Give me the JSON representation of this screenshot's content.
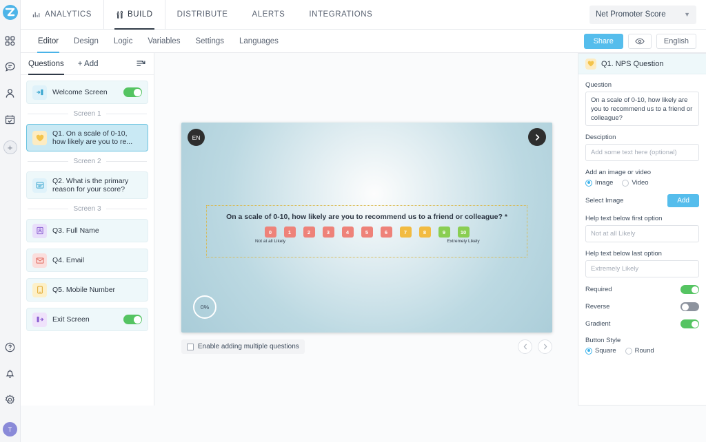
{
  "rail": {
    "logo": "zoho-logo",
    "items": [
      {
        "name": "dashboard-grid-icon"
      },
      {
        "name": "chat-icon"
      },
      {
        "name": "contacts-icon"
      },
      {
        "name": "calendar-check-icon"
      }
    ],
    "add_label": "+",
    "bottom": [
      {
        "name": "help-icon"
      },
      {
        "name": "notifications-icon"
      },
      {
        "name": "settings-gear-icon"
      }
    ],
    "avatar_initial": "T"
  },
  "topnav": {
    "items": [
      {
        "label": "ANALYTICS",
        "icon": "bar-chart-icon",
        "active": false
      },
      {
        "label": "BUILD",
        "icon": "tools-icon",
        "active": true
      },
      {
        "label": "DISTRIBUTE",
        "icon": "",
        "active": false
      },
      {
        "label": "ALERTS",
        "icon": "",
        "active": false
      },
      {
        "label": "INTEGRATIONS",
        "icon": "",
        "active": false
      }
    ],
    "survey_selected": "Net Promoter Score"
  },
  "subnav": {
    "items": [
      {
        "label": "Editor",
        "active": true
      },
      {
        "label": "Design",
        "active": false
      },
      {
        "label": "Logic",
        "active": false
      },
      {
        "label": "Variables",
        "active": false
      },
      {
        "label": "Settings",
        "active": false
      },
      {
        "label": "Languages",
        "active": false
      }
    ],
    "share_label": "Share",
    "preview_icon": "eye-icon",
    "language_label": "English"
  },
  "questions_panel": {
    "tab_label": "Questions",
    "add_label": "+ Add",
    "reorder_icon": "reorder-undo-icon",
    "items": [
      {
        "type": "item",
        "icon": "welcome-screen-icon",
        "label": "Welcome Screen",
        "toggle": "on",
        "selected": false
      },
      {
        "type": "divider",
        "label": "Screen 1"
      },
      {
        "type": "item",
        "icon": "nps-heart-icon",
        "label": "Q1. On a scale of 0-10, how likely are you to re...",
        "toggle": null,
        "selected": true
      },
      {
        "type": "divider",
        "label": "Screen 2"
      },
      {
        "type": "item",
        "icon": "multiline-text-icon",
        "label": "Q2. What is the primary reason for your score?",
        "toggle": null,
        "selected": false
      },
      {
        "type": "divider",
        "label": "Screen 3"
      },
      {
        "type": "item",
        "icon": "name-card-icon",
        "label": "Q3. Full Name",
        "toggle": null,
        "selected": false
      },
      {
        "type": "item",
        "icon": "email-icon",
        "label": "Q4. Email",
        "toggle": null,
        "selected": false
      },
      {
        "type": "item",
        "icon": "mobile-icon",
        "label": "Q5. Mobile Number",
        "toggle": null,
        "selected": false
      },
      {
        "type": "item",
        "icon": "exit-screen-icon",
        "label": "Exit Screen",
        "toggle": "on",
        "selected": false
      }
    ]
  },
  "preview": {
    "language_badge": "EN",
    "next_icon": "chevron-right-icon",
    "question_text": "On a scale of 0-10, how likely are you to recommend us to a friend or colleague? *",
    "scale": [
      {
        "value": "0",
        "color": "#ee8279"
      },
      {
        "value": "1",
        "color": "#ee8279"
      },
      {
        "value": "2",
        "color": "#ee8279"
      },
      {
        "value": "3",
        "color": "#ee8279"
      },
      {
        "value": "4",
        "color": "#ee8279"
      },
      {
        "value": "5",
        "color": "#ee8279"
      },
      {
        "value": "6",
        "color": "#ee8279"
      },
      {
        "value": "7",
        "color": "#f2bb41"
      },
      {
        "value": "8",
        "color": "#f2bb41"
      },
      {
        "value": "9",
        "color": "#8ace52"
      },
      {
        "value": "10",
        "color": "#8ace52"
      }
    ],
    "first_help": "Not at all Likely",
    "last_help": "Extremely Likely",
    "progress": "0%",
    "multi_question_label": "Enable adding multiple questions",
    "prev_icon": "chevron-left-icon",
    "pager_next_icon": "chevron-right-icon"
  },
  "props": {
    "header_title": "Q1. NPS Question",
    "header_icon": "nps-heart-icon",
    "question_label": "Question",
    "question_value": "On a scale of 0-10, how likely are you to recommend us to a friend or colleague?",
    "description_label": "Desciption",
    "description_placeholder": "Add some text here (optional)",
    "media_label": "Add an image or video",
    "media_options": [
      {
        "label": "Image",
        "selected": true
      },
      {
        "label": "Video",
        "selected": false
      }
    ],
    "select_image_label": "Select Image",
    "add_button_label": "Add",
    "first_help_label": "Help text below first option",
    "first_help_value": "Not at all Likely",
    "last_help_label": "Help text below last option",
    "last_help_value": "Extremely Likely",
    "switches": [
      {
        "label": "Required",
        "state": "on"
      },
      {
        "label": "Reverse",
        "state": "off"
      },
      {
        "label": "Gradient",
        "state": "on"
      }
    ],
    "button_style_label": "Button Style",
    "button_style_options": [
      {
        "label": "Square",
        "selected": true
      },
      {
        "label": "Round",
        "selected": false
      }
    ]
  },
  "colors": {
    "accent": "#55bdec",
    "toggle_on": "#55c462",
    "detractor": "#ee8279",
    "passive": "#f2bb41",
    "promoter": "#8ace52"
  }
}
